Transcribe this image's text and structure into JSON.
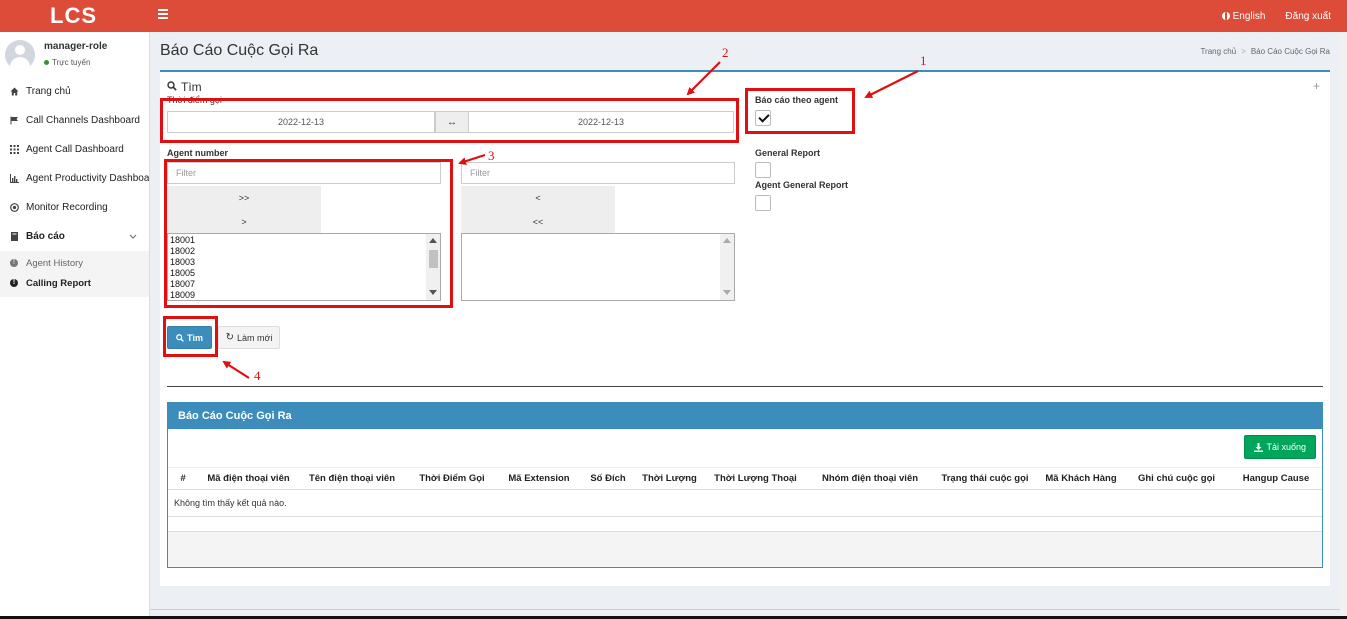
{
  "header": {
    "logo": "LCS",
    "language": "English",
    "logout": "Đăng xuất"
  },
  "sidebar": {
    "user_name": "manager-role",
    "user_status": "Trực tuyến",
    "items": [
      {
        "label": "Trang chủ",
        "icon": "home-icon"
      },
      {
        "label": "Call Channels Dashboard",
        "icon": "flag-icon"
      },
      {
        "label": "Agent Call Dashboard",
        "icon": "grid-icon"
      },
      {
        "label": "Agent Productivity Dashboard",
        "icon": "bar-chart-icon"
      },
      {
        "label": "Monitor Recording",
        "icon": "record-icon"
      },
      {
        "label": "Báo cáo",
        "icon": "book-icon"
      }
    ],
    "subitems": [
      {
        "label": "Agent History"
      },
      {
        "label": "Calling Report"
      }
    ]
  },
  "page": {
    "title": "Báo Cáo Cuộc Gọi Ra",
    "breadcrumb_home": "Trang chủ",
    "breadcrumb_sep": ">",
    "breadcrumb_current": "Báo Cáo Cuộc Gọi Ra"
  },
  "search": {
    "title": "Tìm",
    "time_label": "Thời điểm gọi",
    "date_from": "2022-12-13",
    "date_to": "2022-12-13",
    "range_symbol": "↔",
    "agent_label": "Agent number",
    "filter_placeholder": "Filter",
    "move_all_right": ">>",
    "move_right": ">",
    "move_left": "<",
    "move_all_left": "<<",
    "agent_numbers": [
      "18001",
      "18002",
      "18003",
      "18005",
      "18007",
      "18009"
    ],
    "report_by_agent_label": "Báo cáo theo agent",
    "report_by_agent_checked": true,
    "general_report_label": "General Report",
    "agent_general_report_label": "Agent General Report",
    "search_button": "Tìm",
    "reset_button": "Làm mới"
  },
  "results": {
    "title": "Báo Cáo Cuộc Gọi Ra",
    "download_button": "Tải xuống",
    "columns": [
      "#",
      "Mã điện thoại viên",
      "Tên điện thoại viên",
      "Thời Điểm Gọi",
      "Mã Extension",
      "Số Đích",
      "Thời Lượng",
      "Thời Lượng Thoại",
      "Nhóm điện thoại viên",
      "Trạng thái cuộc gọi",
      "Mã Khách Hàng",
      "Ghi chú cuộc gọi",
      "Hangup Cause"
    ],
    "empty_message": "Không tìm thấy kết quả nào."
  },
  "annotations": [
    "1",
    "2",
    "3",
    "4"
  ],
  "colors": {
    "header": "#dd4b39",
    "primary": "#3c8dbc",
    "success": "#00a65a",
    "annotation": "#e01010"
  }
}
